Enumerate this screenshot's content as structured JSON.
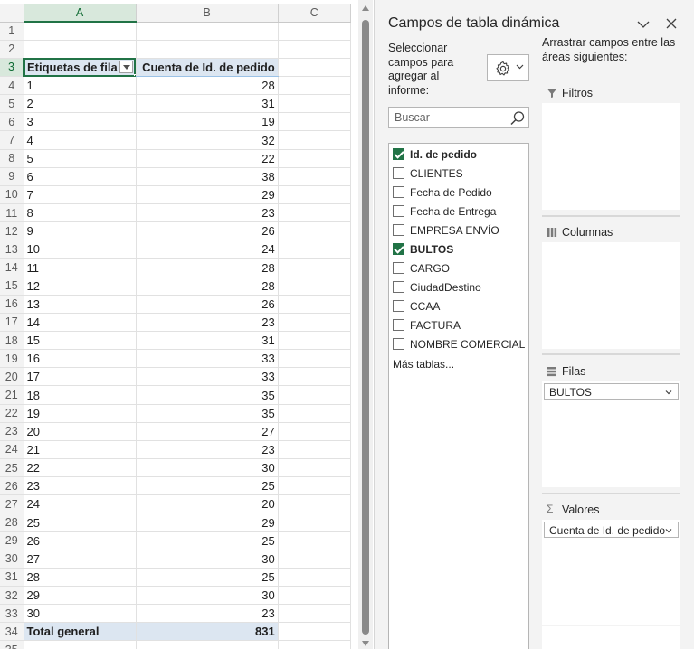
{
  "sheet": {
    "columns": [
      "A",
      "B",
      "C"
    ],
    "rows": [
      {
        "num": "1",
        "a": "",
        "b": ""
      },
      {
        "num": "2",
        "a": "",
        "b": ""
      },
      {
        "num": "3",
        "a": "Etiquetas de fila",
        "b": "Cuenta de Id. de pedido"
      },
      {
        "num": "4",
        "a": "1",
        "b": "28"
      },
      {
        "num": "5",
        "a": "2",
        "b": "31"
      },
      {
        "num": "6",
        "a": "3",
        "b": "19"
      },
      {
        "num": "7",
        "a": "4",
        "b": "32"
      },
      {
        "num": "8",
        "a": "5",
        "b": "22"
      },
      {
        "num": "9",
        "a": "6",
        "b": "38"
      },
      {
        "num": "10",
        "a": "7",
        "b": "29"
      },
      {
        "num": "11",
        "a": "8",
        "b": "23"
      },
      {
        "num": "12",
        "a": "9",
        "b": "26"
      },
      {
        "num": "13",
        "a": "10",
        "b": "24"
      },
      {
        "num": "14",
        "a": "11",
        "b": "28"
      },
      {
        "num": "15",
        "a": "12",
        "b": "28"
      },
      {
        "num": "16",
        "a": "13",
        "b": "26"
      },
      {
        "num": "17",
        "a": "14",
        "b": "23"
      },
      {
        "num": "18",
        "a": "15",
        "b": "31"
      },
      {
        "num": "19",
        "a": "16",
        "b": "33"
      },
      {
        "num": "20",
        "a": "17",
        "b": "33"
      },
      {
        "num": "21",
        "a": "18",
        "b": "35"
      },
      {
        "num": "22",
        "a": "19",
        "b": "35"
      },
      {
        "num": "23",
        "a": "20",
        "b": "27"
      },
      {
        "num": "24",
        "a": "21",
        "b": "23"
      },
      {
        "num": "25",
        "a": "22",
        "b": "30"
      },
      {
        "num": "26",
        "a": "23",
        "b": "25"
      },
      {
        "num": "27",
        "a": "24",
        "b": "20"
      },
      {
        "num": "28",
        "a": "25",
        "b": "29"
      },
      {
        "num": "29",
        "a": "26",
        "b": "25"
      },
      {
        "num": "30",
        "a": "27",
        "b": "30"
      },
      {
        "num": "31",
        "a": "28",
        "b": "25"
      },
      {
        "num": "32",
        "a": "29",
        "b": "30"
      },
      {
        "num": "33",
        "a": "30",
        "b": "23"
      },
      {
        "num": "34",
        "a": "Total general",
        "b": "831"
      },
      {
        "num": "35",
        "a": "",
        "b": ""
      }
    ]
  },
  "pivot": {
    "title": "Campos de tabla dinámica",
    "choose_label": "Seleccionar campos para agregar al informe:",
    "search_placeholder": "Buscar",
    "fields": [
      {
        "label": "Id. de pedido",
        "checked": true
      },
      {
        "label": "CLIENTES",
        "checked": false
      },
      {
        "label": "Fecha de Pedido",
        "checked": false
      },
      {
        "label": "Fecha de Entrega",
        "checked": false
      },
      {
        "label": "EMPRESA ENVÍO",
        "checked": false
      },
      {
        "label": "BULTOS",
        "checked": true
      },
      {
        "label": "CARGO",
        "checked": false
      },
      {
        "label": "CiudadDestino",
        "checked": false
      },
      {
        "label": "CCAA",
        "checked": false
      },
      {
        "label": "FACTURA",
        "checked": false
      },
      {
        "label": "NOMBRE COMERCIAL",
        "checked": false
      }
    ],
    "more_tables": "Más tablas...",
    "drag_label": "Arrastrar campos entre las áreas siguientes:",
    "areas": {
      "filters": {
        "label": "Filtros",
        "icon": "filter-icon"
      },
      "columns": {
        "label": "Columnas",
        "icon": "columns-icon"
      },
      "rows": {
        "label": "Filas",
        "icon": "rows-icon",
        "item": "BULTOS"
      },
      "values": {
        "label": "Valores",
        "icon": "sigma-icon",
        "item": "Cuenta de Id. de pedido"
      }
    }
  },
  "colors": {
    "accent": "#217346",
    "pivot_header": "#dce6f1"
  }
}
